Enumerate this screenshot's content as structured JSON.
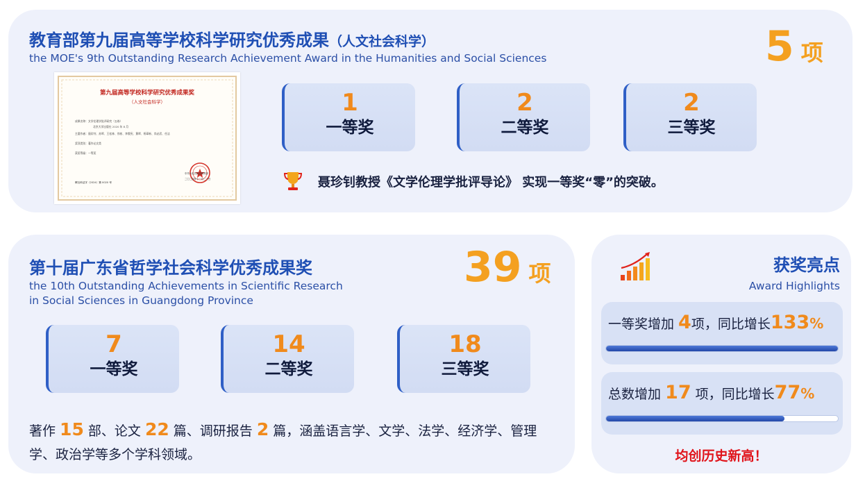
{
  "moe_award": {
    "title_cn": "教育部第九届高等学校科学研究优秀成果",
    "title_cn_paren": "（人文社会科学）",
    "title_en": "the MOE's 9th Outstanding Research Achievement Award in the Humanities and Social Sciences",
    "total_num": "5",
    "total_unit": "项",
    "cards": [
      {
        "count": "1",
        "level": "一等奖"
      },
      {
        "count": "2",
        "level": "二等奖"
      },
      {
        "count": "2",
        "level": "三等奖"
      }
    ],
    "highlight": "聂珍钊教授《文学伦理学批评导论》 实现一等奖“零”的突破。",
    "certificate": {
      "title": "第九届高等学校科学研究优秀成果奖",
      "subtitle": "（人文社会科学）",
      "row1": "成果名称：文学伦理学批评研究（五卷）",
      "row2": "北京大学出版社 2020 年 8 月",
      "row3": "主要作者：聂珍钊、苏晖、王松林、徐彬、李俄宪、黄晖、杨革新、尚必武、任洁",
      "row4": "奖项类别：著作论文类",
      "row5": "获奖等级：一等奖",
      "footer_left": "教社科证字（2024）第 0020 号",
      "footer_right1": "中华人民共和国教育部",
      "footer_right2": "二〇二四年十一月二十日"
    }
  },
  "gd_award": {
    "title_cn": "第十届广东省哲学社会科学优秀成果奖",
    "title_en_line1": "the 10th Outstanding Achievements in Scientific Research",
    "title_en_line2": "in Social Sciences in Guangdong Province",
    "total_num": "39",
    "total_unit": "项",
    "cards": [
      {
        "count": "7",
        "level": "一等奖"
      },
      {
        "count": "14",
        "level": "二等奖"
      },
      {
        "count": "18",
        "level": "三等奖"
      }
    ],
    "desc": {
      "p1": "著作 ",
      "n1": "15",
      "p2": " 部、论文 ",
      "n2": "22",
      "p3": " 篇、调研报告 ",
      "n3": "2",
      "p4": " 篇，涵盖语言学、文学、法学、经济学、管理学、政治学等多个学科领域。"
    }
  },
  "highlights": {
    "title_cn": "获奖亮点",
    "title_en": "Award Highlights",
    "stats": [
      {
        "pre": "一等奖增加 ",
        "num": "4",
        "mid": "项，同比增长",
        "pct": "133",
        "pct_sign": "%",
        "progress": 1.0
      },
      {
        "pre": "总数增加 ",
        "num": "17",
        "mid": " 项，同比增长",
        "pct": "77",
        "pct_sign": "%",
        "progress": 0.77
      }
    ],
    "footer": "均创历史新高！"
  },
  "colors": {
    "title_blue": "#1f4fb4",
    "accent_orange": "#f08a1c",
    "count_gold": "#f4a020",
    "panel_bg": "#eef1fb",
    "red": "#e0141b"
  },
  "icons": {
    "trophy": "trophy-icon",
    "chart": "bar-chart-growth-icon"
  }
}
